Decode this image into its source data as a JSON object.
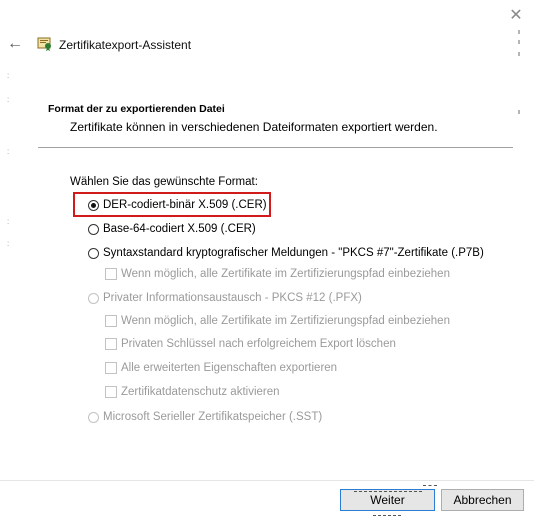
{
  "window": {
    "close_glyph": "✕"
  },
  "header": {
    "back_glyph": "←",
    "title": "Zertifikatexport-Assistent"
  },
  "page": {
    "heading": "Format der zu exportierenden Datei",
    "description": "Zertifikate können in verschiedenen Dateiformaten exportiert werden.",
    "format_label": "Wählen Sie das gewünschte Format:"
  },
  "options": {
    "der": {
      "label": "DER-codiert-binär X.509 (.CER)",
      "selected": true,
      "enabled": true
    },
    "base64": {
      "label": "Base-64-codiert X.509 (.CER)",
      "selected": false,
      "enabled": true
    },
    "pkcs7": {
      "label": "Syntaxstandard kryptografischer Meldungen - \"PKCS #7\"-Zertifikate (.P7B)",
      "selected": false,
      "enabled": true
    },
    "pkcs7_chain": {
      "label": "Wenn möglich, alle Zertifikate im Zertifizierungspfad einbeziehen",
      "checked": false,
      "enabled": false
    },
    "pfx": {
      "label": "Privater Informationsaustausch - PKCS #12 (.PFX)",
      "selected": false,
      "enabled": false
    },
    "pfx_chain": {
      "label": "Wenn möglich, alle Zertifikate im Zertifizierungspfad einbeziehen",
      "checked": false,
      "enabled": false
    },
    "pfx_delete_key": {
      "label": "Privaten Schlüssel nach erfolgreichem Export löschen",
      "checked": false,
      "enabled": false
    },
    "pfx_ext_props": {
      "label": "Alle erweiterten Eigenschaften exportieren",
      "checked": false,
      "enabled": false
    },
    "pfx_privacy": {
      "label": "Zertifikatdatenschutz aktivieren",
      "checked": false,
      "enabled": false
    },
    "sst": {
      "label": "Microsoft Serieller Zertifikatspeicher (.SST)",
      "selected": false,
      "enabled": false
    }
  },
  "buttons": {
    "next": "Weiter",
    "cancel": "Abbrechen"
  },
  "colors": {
    "highlight": "#d11a1a",
    "focus_border": "#2b7cd3",
    "disabled_text": "#9a9a9a"
  }
}
